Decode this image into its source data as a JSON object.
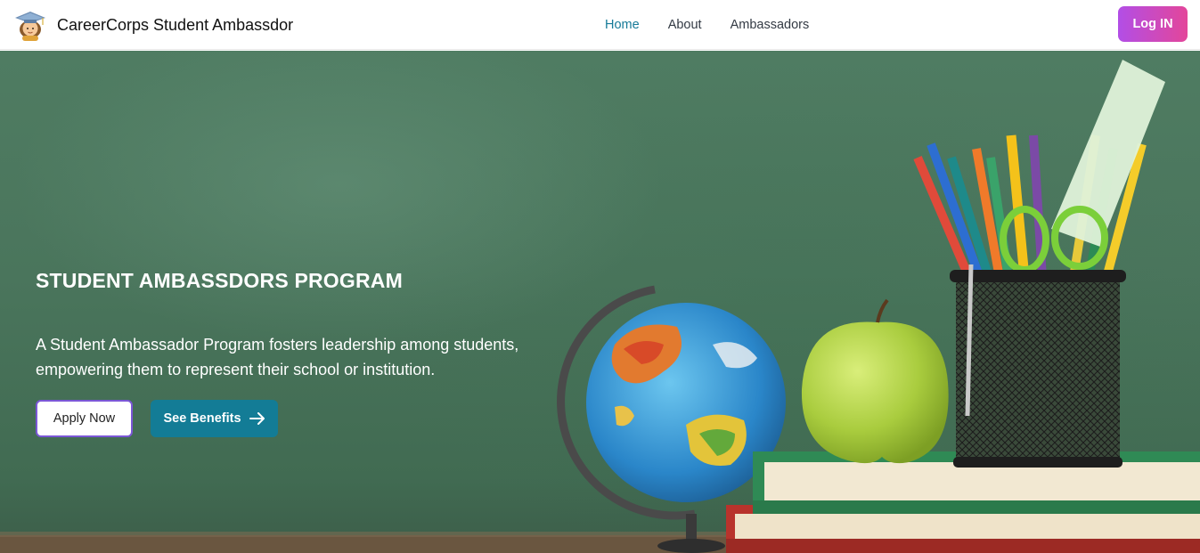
{
  "navbar": {
    "brand_name": "CareerCorps Student Ambassdor",
    "logo_icon": "graduate-student-icon",
    "links": [
      {
        "label": "Home",
        "active": true
      },
      {
        "label": "About",
        "active": false
      },
      {
        "label": "Ambassadors",
        "active": false
      }
    ],
    "login_label": "Log IN"
  },
  "hero": {
    "title": "STUDENT AMBASSDORS PROGRAM",
    "description": "A Student Ambassador Program fosters leadership among students, empowering them to represent their school or institution.",
    "apply_label": "Apply Now",
    "benefits_label": "See Benefits",
    "benefits_icon": "arrow-right-icon"
  },
  "colors": {
    "accent": "#167a98",
    "login_gradient_start": "#b24ee6",
    "login_gradient_end": "#e3469a",
    "benefits_button": "#137c96",
    "chalkboard": "#4a755c"
  }
}
